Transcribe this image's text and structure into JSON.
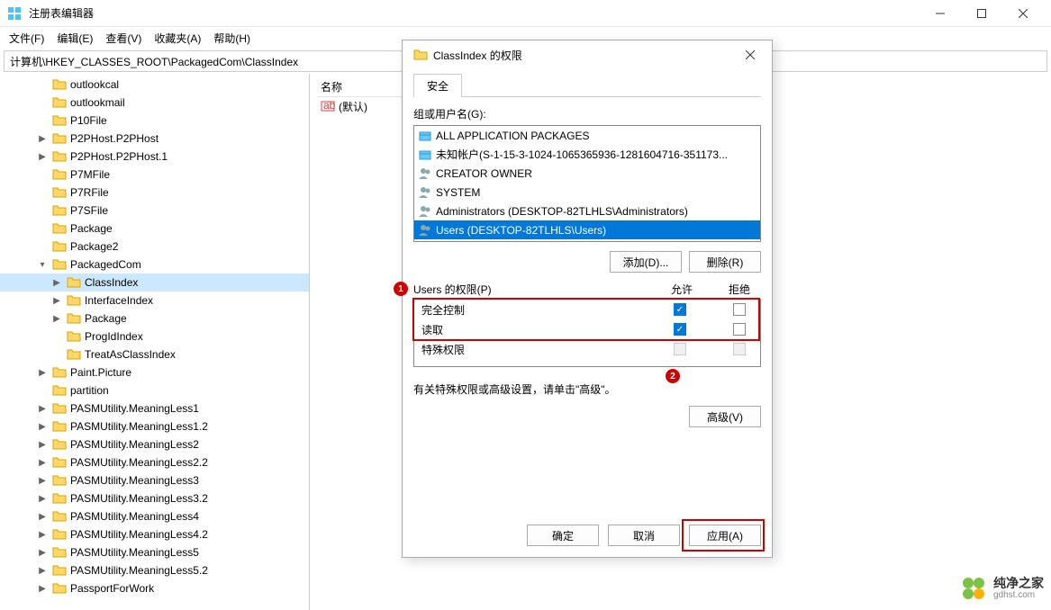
{
  "window": {
    "title": "注册表编辑器"
  },
  "menu": {
    "file": "文件(F)",
    "edit": "编辑(E)",
    "view": "查看(V)",
    "favorites": "收藏夹(A)",
    "help": "帮助(H)"
  },
  "addressbar": {
    "path": "计算机\\HKEY_CLASSES_ROOT\\PackagedCom\\ClassIndex"
  },
  "columns": {
    "name": "名称"
  },
  "values": {
    "default": "(默认)"
  },
  "tree": [
    {
      "label": "outlookcal",
      "indent": 2,
      "exp": ""
    },
    {
      "label": "outlookmail",
      "indent": 2,
      "exp": ""
    },
    {
      "label": "P10File",
      "indent": 2,
      "exp": ""
    },
    {
      "label": "P2PHost.P2PHost",
      "indent": 2,
      "exp": ">"
    },
    {
      "label": "P2PHost.P2PHost.1",
      "indent": 2,
      "exp": ">"
    },
    {
      "label": "P7MFile",
      "indent": 2,
      "exp": ""
    },
    {
      "label": "P7RFile",
      "indent": 2,
      "exp": ""
    },
    {
      "label": "P7SFile",
      "indent": 2,
      "exp": ""
    },
    {
      "label": "Package",
      "indent": 2,
      "exp": ""
    },
    {
      "label": "Package2",
      "indent": 2,
      "exp": ""
    },
    {
      "label": "PackagedCom",
      "indent": 2,
      "exp": "v",
      "open": true
    },
    {
      "label": "ClassIndex",
      "indent": 3,
      "exp": ">",
      "selected": true
    },
    {
      "label": "InterfaceIndex",
      "indent": 3,
      "exp": ">"
    },
    {
      "label": "Package",
      "indent": 3,
      "exp": ">"
    },
    {
      "label": "ProgIdIndex",
      "indent": 3,
      "exp": ""
    },
    {
      "label": "TreatAsClassIndex",
      "indent": 3,
      "exp": ""
    },
    {
      "label": "Paint.Picture",
      "indent": 2,
      "exp": ">"
    },
    {
      "label": "partition",
      "indent": 2,
      "exp": ""
    },
    {
      "label": "PASMUtility.MeaningLess1",
      "indent": 2,
      "exp": ">"
    },
    {
      "label": "PASMUtility.MeaningLess1.2",
      "indent": 2,
      "exp": ">"
    },
    {
      "label": "PASMUtility.MeaningLess2",
      "indent": 2,
      "exp": ">"
    },
    {
      "label": "PASMUtility.MeaningLess2.2",
      "indent": 2,
      "exp": ">"
    },
    {
      "label": "PASMUtility.MeaningLess3",
      "indent": 2,
      "exp": ">"
    },
    {
      "label": "PASMUtility.MeaningLess3.2",
      "indent": 2,
      "exp": ">"
    },
    {
      "label": "PASMUtility.MeaningLess4",
      "indent": 2,
      "exp": ">"
    },
    {
      "label": "PASMUtility.MeaningLess4.2",
      "indent": 2,
      "exp": ">"
    },
    {
      "label": "PASMUtility.MeaningLess5",
      "indent": 2,
      "exp": ">"
    },
    {
      "label": "PASMUtility.MeaningLess5.2",
      "indent": 2,
      "exp": ">"
    },
    {
      "label": "PassportForWork",
      "indent": 2,
      "exp": ">"
    }
  ],
  "dialog": {
    "title": "ClassIndex 的权限",
    "tab_security": "安全",
    "groups_label": "组或用户名(G):",
    "groups": [
      {
        "text": "ALL APPLICATION PACKAGES",
        "icon": "pkg"
      },
      {
        "text": "未知帐户(S-1-15-3-1024-1065365936-1281604716-351173...",
        "icon": "pkg"
      },
      {
        "text": "CREATOR OWNER",
        "icon": "users"
      },
      {
        "text": "SYSTEM",
        "icon": "users"
      },
      {
        "text": "Administrators (DESKTOP-82TLHLS\\Administrators)",
        "icon": "users"
      },
      {
        "text": "Users (DESKTOP-82TLHLS\\Users)",
        "icon": "users",
        "selected": true
      }
    ],
    "add_btn": "添加(D)...",
    "remove_btn": "删除(R)",
    "perm_label": "Users 的权限(P)",
    "col_allow": "允许",
    "col_deny": "拒绝",
    "perms": [
      {
        "name": "完全控制",
        "allow": true,
        "deny": false
      },
      {
        "name": "读取",
        "allow": true,
        "deny": false
      },
      {
        "name": "特殊权限",
        "allow": false,
        "deny": false,
        "disabled": true
      }
    ],
    "advanced_text": "有关特殊权限或高级设置，请单击\"高级\"。",
    "advanced_btn": "高级(V)",
    "ok_btn": "确定",
    "cancel_btn": "取消",
    "apply_btn": "应用(A)"
  },
  "annotations": {
    "badge1": "1",
    "badge2": "2"
  },
  "watermark": {
    "title": "纯净之家",
    "sub": "gdhst.com"
  }
}
